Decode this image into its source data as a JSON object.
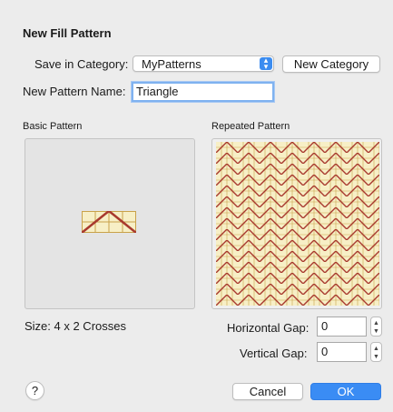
{
  "dialog": {
    "title": "New Fill Pattern",
    "save_in_category_label": "Save in Category:",
    "category_value": "MyPatterns",
    "new_category_label": "New Category",
    "pattern_name_label": "New Pattern Name:",
    "pattern_name_value": "Triangle",
    "basic_pattern_label": "Basic Pattern",
    "repeated_pattern_label": "Repeated Pattern",
    "size_text": "Size: 4 x 2 Crosses",
    "horizontal_gap_label": "Horizontal Gap:",
    "horizontal_gap_value": "0",
    "vertical_gap_label": "Vertical Gap:",
    "vertical_gap_value": "0",
    "help_label": "?",
    "cancel_label": "Cancel",
    "ok_label": "OK"
  },
  "colors": {
    "accent": "#3a8cf4",
    "pattern_fill": "#f7efc6",
    "pattern_grid": "#c9a24a",
    "stitch": "#a8392e"
  },
  "icons": {
    "popup_arrow": "chevron-updown-icon",
    "stepper": "stepper-icon",
    "help": "question-icon"
  }
}
